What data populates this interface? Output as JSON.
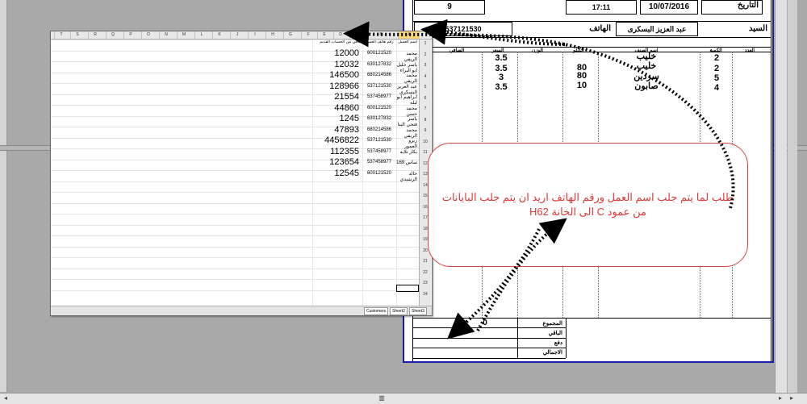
{
  "invoice": {
    "date_label": "التاريخ",
    "date_value": "10/07/2016",
    "time_value": "17:11",
    "invoice_no": "9",
    "customer_label": "السيد",
    "customer_name": "عبد العزيز البسكرى",
    "phone_label": "الهاتف",
    "phone_value": "537121530",
    "columns": [
      "العدد",
      "الكمية",
      "اسم الصنف",
      "الكيلو",
      "الوزن",
      "السعر",
      "الصافي"
    ],
    "items": [
      {
        "qty": "2",
        "name": "خليب",
        "weight": "",
        "price": "3.5"
      },
      {
        "qty": "2",
        "name": "خليب",
        "weight": "80",
        "price": "3.5"
      },
      {
        "qty": "5",
        "name": "سردين",
        "weight": "80",
        "price": "3"
      },
      {
        "qty": "4",
        "name": "صابون",
        "weight": "10",
        "price": "3.5"
      }
    ],
    "total_label": "المجموع",
    "total_value": "0",
    "remaining_label": "الباقي",
    "paid_label": "دفع",
    "grand_label": "الاجمالي"
  },
  "sheet": {
    "col_letters": [
      "T",
      "S",
      "R",
      "Q",
      "P",
      "O",
      "N",
      "M",
      "L",
      "K",
      "J",
      "I",
      "H",
      "G",
      "F",
      "E",
      "D",
      "C",
      "B",
      "A"
    ],
    "headers": {
      "balance": "الباقي من الحساب القديم",
      "phone": "رقم هاتف العميل",
      "name": "اسم العميل"
    },
    "rows": [
      {
        "balance": "12000",
        "phone": "600121520",
        "name": "محمد الريفي"
      },
      {
        "balance": "12032",
        "phone": "630127832",
        "name": "ياسر خليل ابو البراء"
      },
      {
        "balance": "146500",
        "phone": "680214586",
        "name": "محمد الريفي"
      },
      {
        "balance": "128966",
        "phone": "537121530",
        "name": "عبد العزيز البسكرى"
      },
      {
        "balance": "21554",
        "phone": "537458977",
        "name": "ابراهيم ابو ليله"
      },
      {
        "balance": "44860",
        "phone": "600121520",
        "name": "محمد حسن"
      },
      {
        "balance": "1245",
        "phone": "630127832",
        "name": "ياسر فتحي البنا"
      },
      {
        "balance": "47893",
        "phone": "680214586",
        "name": "محمد الريفي"
      },
      {
        "balance": "4456822",
        "phone": "537121530",
        "name": "زيزو العمور"
      },
      {
        "balance": "112355",
        "phone": "537458977",
        "name": "بكار تلايه"
      },
      {
        "balance": "123654",
        "phone": "537458977",
        "name": "ساس 169"
      },
      {
        "balance": "12545",
        "phone": "600121520",
        "name": "خالد الرشيدي"
      }
    ],
    "tabs": [
      "Customers",
      "Sheet2",
      "Sheet3"
    ]
  },
  "callout": {
    "text": "طلب لما يتم جلب اسم العمل ورقم الهاتف اريد ان يتم جلب البايانات من عمود C الى الخانة H62"
  },
  "colors": {
    "arrow": "#000000",
    "callout_border": "#d94343",
    "callout_text": "#d93a3a",
    "invoice_border": "#1a1aa8"
  }
}
